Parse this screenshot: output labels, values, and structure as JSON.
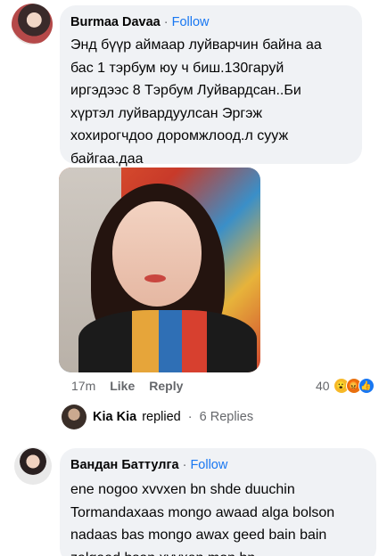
{
  "comment1": {
    "author": "Burmaa Davaa",
    "separator": "·",
    "follow_label": "Follow",
    "text_lines": [
      "Энд бүүр аймаар луйварчин байна аа",
      "бас 1 тэрбум юу ч биш.130гаруй",
      "иргэдээс 8 Тэрбум Луйвардсан..Би",
      "хүртэл луйвардуулсан Эргэж",
      "хохирогчдоо доромжлоод.л сууж",
      "байгаа.даа"
    ],
    "time": "17m",
    "like_label": "Like",
    "reply_label": "Reply",
    "reaction_count": "40",
    "reaction_icons": [
      "wow-emoji-icon",
      "angry-emoji-icon",
      "like-emoji-icon"
    ]
  },
  "reply_summary": {
    "name": "Kia Kia",
    "verb": "replied",
    "separator": "·",
    "count": "6 Replies"
  },
  "comment2": {
    "author": "Вандан Баттулга",
    "separator": "·",
    "follow_label": "Follow",
    "text_lines": [
      "ene nogoo xvvxen bn shde duuchin",
      "Tormandaxaas mongo awaad alga bolson",
      "nadaas bas mongo awax geed bain bain",
      "zalgaad bsan xvvxen mon bn"
    ]
  }
}
